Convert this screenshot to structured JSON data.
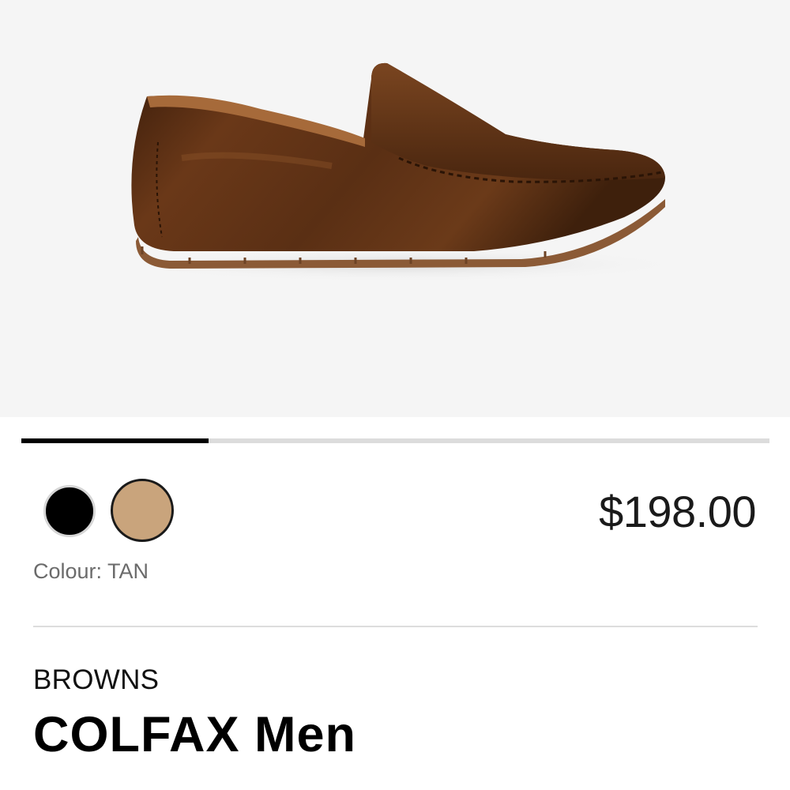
{
  "carousel": {
    "progress_fraction": 0.25
  },
  "colours": {
    "options": [
      {
        "name": "black",
        "hex": "#000000",
        "selected": false
      },
      {
        "name": "tan",
        "hex": "#c9a47c",
        "selected": true
      }
    ],
    "label": "Colour: TAN"
  },
  "price": "$198.00",
  "product": {
    "brand": "BROWNS",
    "name": "COLFAX Men",
    "image_icon": "loafer-shoe-image",
    "leather_color": "#5a2f14",
    "sole_color": "#8b5a36"
  }
}
